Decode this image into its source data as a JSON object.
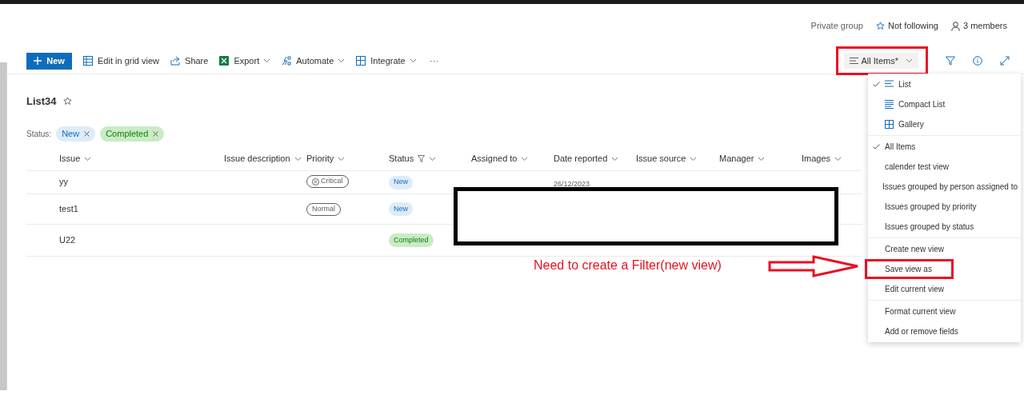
{
  "header": {
    "privacy": "Private group",
    "follow": "Not following",
    "members": "3 members"
  },
  "toolbar": {
    "new": "New",
    "actions": [
      {
        "label": "Edit in grid view",
        "dropdown": false
      },
      {
        "label": "Share",
        "dropdown": false
      },
      {
        "label": "Export",
        "dropdown": true
      },
      {
        "label": "Automate",
        "dropdown": true
      },
      {
        "label": "Integrate",
        "dropdown": true
      }
    ],
    "more": "···",
    "view": "All Items*"
  },
  "list": {
    "title": "List34",
    "filter_label": "Status:",
    "filters": [
      {
        "label": "New",
        "color": "#deecf9"
      },
      {
        "label": "Completed",
        "color": "#c9ecc4"
      }
    ]
  },
  "table": {
    "columns": [
      {
        "label": "Issue",
        "filtered": false
      },
      {
        "label": "Issue description",
        "filtered": false
      },
      {
        "label": "Priority",
        "filtered": false
      },
      {
        "label": "Status",
        "filtered": true
      },
      {
        "label": "Assigned to",
        "filtered": false
      },
      {
        "label": "Date reported",
        "filtered": false
      },
      {
        "label": "Issue source",
        "filtered": false
      },
      {
        "label": "Manager",
        "filtered": false
      },
      {
        "label": "Images",
        "filtered": false
      }
    ],
    "rows": [
      {
        "issue": "yy",
        "priority": {
          "label": "Critical",
          "icon": true
        },
        "status": {
          "label": "New",
          "color": "#deecf9"
        },
        "date": "26/12/2023"
      },
      {
        "issue": "test1",
        "priority": {
          "label": "Normal",
          "icon": false
        },
        "status": {
          "label": "New",
          "color": "#deecf9"
        }
      },
      {
        "issue": "U22",
        "status": {
          "label": "Completed",
          "color": "#c9ecc4"
        }
      }
    ]
  },
  "view_menu": [
    [
      {
        "label": "List",
        "checked": true
      },
      {
        "label": "Compact List",
        "checked": false
      },
      {
        "label": "Gallery",
        "checked": false
      }
    ],
    [
      {
        "label": "All Items",
        "checked": true
      },
      {
        "label": "calender test view",
        "checked": false
      },
      {
        "label": "Issues grouped by person assigned to",
        "checked": false
      },
      {
        "label": "Issues grouped by priority",
        "checked": false
      },
      {
        "label": "Issues grouped by status",
        "checked": false
      }
    ],
    [
      {
        "label": "Create new view",
        "checked": false
      },
      {
        "label": "Save view as",
        "checked": false
      },
      {
        "label": "Edit current view",
        "checked": false
      }
    ],
    [
      {
        "label": "Format current view",
        "checked": false
      },
      {
        "label": "Add or remove fields",
        "checked": false
      }
    ]
  ],
  "annotation": {
    "text": "Need to create a Filter(new view)"
  }
}
